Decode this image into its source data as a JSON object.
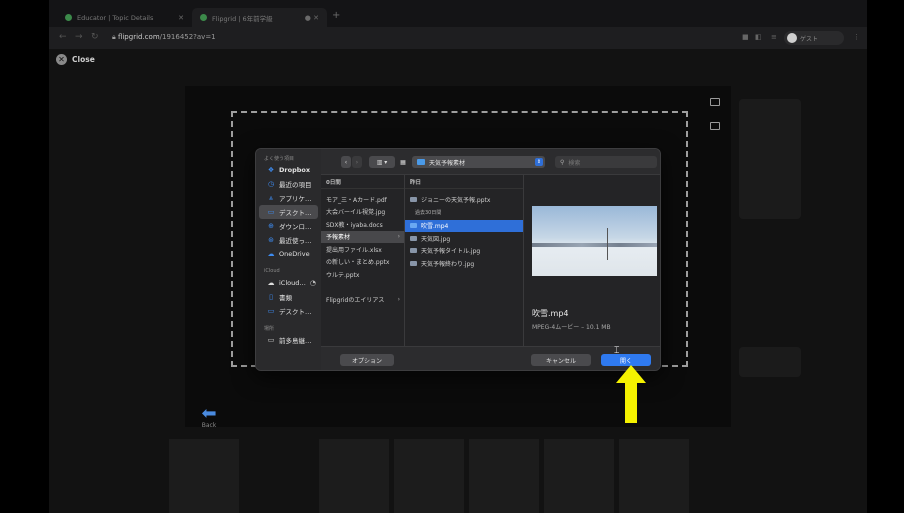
{
  "browser": {
    "tabs": [
      {
        "label": "Educator | Topic Details",
        "active": false
      },
      {
        "label": "Flipgrid | 6年前学級",
        "active": true
      }
    ],
    "url_host": "flipgrid.com",
    "url_path": "/1916452?av=1",
    "guest_label": "ゲスト"
  },
  "page": {
    "close_label": "Close",
    "back_label": "Back"
  },
  "dialog": {
    "sidebar": {
      "favorites_header": "よく使う項目",
      "favorites": [
        {
          "icon": "dropbox-icon",
          "label": "Dropbox"
        },
        {
          "icon": "clock-icon",
          "label": "最近の項目"
        },
        {
          "icon": "apps-icon",
          "label": "アプリケ…"
        },
        {
          "icon": "desktop-icon",
          "label": "デスクト…",
          "selected": true
        },
        {
          "icon": "download-icon",
          "label": "ダウンロ…"
        },
        {
          "icon": "recent-icon",
          "label": "最近使っ…"
        },
        {
          "icon": "cloud-icon",
          "label": "OneDrive"
        }
      ],
      "icloud_header": "iCloud",
      "icloud": [
        {
          "icon": "cloud-icon",
          "label": "iCloud…"
        },
        {
          "icon": "doc-icon",
          "label": "書類"
        },
        {
          "icon": "desktop-icon",
          "label": "デスクト…"
        }
      ],
      "places_header": "場所",
      "places": [
        {
          "icon": "display-icon",
          "label": "前多島継…"
        }
      ]
    },
    "toolbar": {
      "folder_name": "天気予報素材",
      "search_placeholder": "検索"
    },
    "col1": {
      "header": "0日間",
      "rows": [
        "モア_三・Aカード.pdf",
        "大会バーイル視覚.jpg",
        "SDX教・iyaba.docs",
        "予報素材",
        "提出用ファイル.xlsx",
        "の新しい・まとめ.pptx",
        "ウルテ.pptx",
        "",
        "Flipgridのエイリアス"
      ]
    },
    "col2": {
      "header": "昨日",
      "rows_yesterday": [
        "ジョニーの天気予報.pptx"
      ],
      "subheader": "過去30日間",
      "rows_past": [
        "吹雪.mp4",
        "天気図.jpg",
        "天気予報タイトル.jpg",
        "天気予報終わり.jpg"
      ]
    },
    "preview": {
      "name": "吹雪.mp4",
      "meta": "MPEG-4ムービー – 10.1 MB"
    },
    "footer": {
      "options_label": "オプション",
      "cancel_label": "キャンセル",
      "open_label": "開く"
    }
  },
  "colors": {
    "accent_blue": "#2f7af0",
    "annotation_yellow": "#f5f200"
  }
}
